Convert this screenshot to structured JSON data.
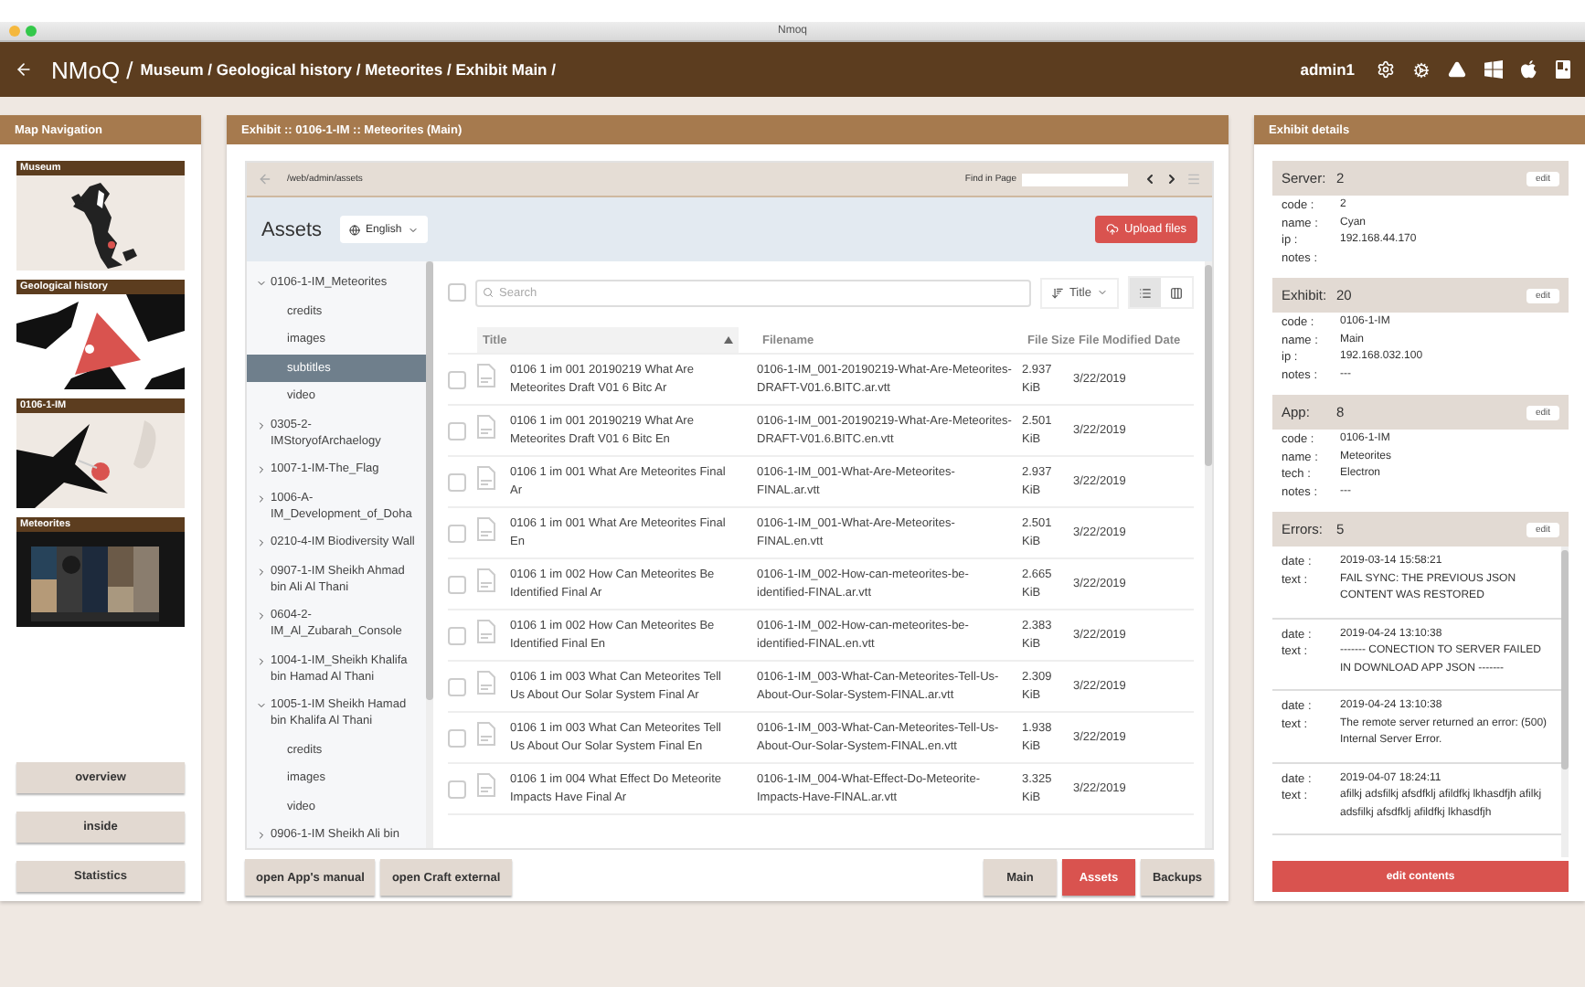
{
  "window": {
    "title": "Nmoq"
  },
  "header": {
    "root": "NMoQ /",
    "breadcrumb": "Museum / Geological history / Meteorites / Exhibit Main /",
    "user": "admin1"
  },
  "map_navigation": {
    "title": "Map Navigation",
    "maps": [
      {
        "label": "Museum",
        "kind": "museum"
      },
      {
        "label": "Geological history",
        "kind": "geology"
      },
      {
        "label": "0106-1-IM",
        "kind": "exhibit"
      },
      {
        "label": "Meteorites",
        "kind": "screenshot"
      }
    ],
    "buttons": [
      "overview",
      "inside",
      "Statistics"
    ]
  },
  "exhibit": {
    "title": "Exhibit :: 0106-1-IM :: Meteorites (Main)",
    "path": "/web/admin/assets",
    "find_label": "Find in Page",
    "assets_title": "Assets",
    "language": "English",
    "upload_button": "Upload files",
    "tree": [
      {
        "label": "0106-1-IM_Meteorites",
        "expanded": true,
        "selected": false,
        "children": [
          {
            "label": "credits",
            "selected": false
          },
          {
            "label": "images",
            "selected": false
          },
          {
            "label": "subtitles",
            "selected": true
          },
          {
            "label": "video",
            "selected": false
          }
        ]
      },
      {
        "label": "0305-2-IMStoryofArchaelogy",
        "expanded": false,
        "selected": false
      },
      {
        "label": "1007-1-IM-The_Flag",
        "expanded": false,
        "selected": false
      },
      {
        "label": "1006-A-IM_Development_of_Doha",
        "expanded": false,
        "selected": false
      },
      {
        "label": "0210-4-IM Biodiversity Wall",
        "expanded": false,
        "selected": false
      },
      {
        "label": "0907-1-IM Sheikh Ahmad bin Ali Al Thani",
        "expanded": false,
        "selected": false
      },
      {
        "label": "0604-2-IM_Al_Zubarah_Console",
        "expanded": false,
        "selected": false
      },
      {
        "label": "1004-1-IM_Sheikh Khalifa bin Hamad Al Thani",
        "expanded": false,
        "selected": false
      },
      {
        "label": "1005-1-IM Sheikh Hamad bin Khalifa Al Thani",
        "expanded": true,
        "selected": false,
        "children": [
          {
            "label": "credits",
            "selected": false
          },
          {
            "label": "images",
            "selected": false
          },
          {
            "label": "video",
            "selected": false
          }
        ]
      },
      {
        "label": "0906-1-IM Sheikh Ali bin",
        "expanded": false,
        "selected": false
      }
    ],
    "select_all": {
      "checked": false
    },
    "search": {
      "placeholder": "Search"
    },
    "sort_by": "Title",
    "views": [
      {
        "kind": "list",
        "selected": true
      },
      {
        "kind": "grid",
        "selected": false
      }
    ],
    "table": {
      "columns": [
        {
          "label": "Title",
          "sorted": true
        },
        {
          "label": "Filename",
          "sorted": false
        },
        {
          "label": "File Size",
          "sorted": false
        },
        {
          "label": "File Modified Date",
          "sorted": false
        }
      ],
      "rows": [
        {
          "checked": false,
          "title": "0106 1 im 001 20190219 What Are Meteorites Draft V01 6 Bitc Ar",
          "filename": "0106-1-IM_001-20190219-What-Are-Meteorites-DRAFT-V01.6.BITC.ar.vtt",
          "size": "2.937 KiB",
          "date": "3/22/2019"
        },
        {
          "checked": false,
          "title": "0106 1 im 001 20190219 What Are Meteorites Draft V01 6 Bitc En",
          "filename": "0106-1-IM_001-20190219-What-Are-Meteorites-DRAFT-V01.6.BITC.en.vtt",
          "size": "2.501 KiB",
          "date": "3/22/2019"
        },
        {
          "checked": false,
          "title": "0106 1 im 001 What Are Meteorites Final Ar",
          "filename": "0106-1-IM_001-What-Are-Meteorites-FINAL.ar.vtt",
          "size": "2.937 KiB",
          "date": "3/22/2019"
        },
        {
          "checked": false,
          "title": "0106 1 im 001 What Are Meteorites Final En",
          "filename": "0106-1-IM_001-What-Are-Meteorites-FINAL.en.vtt",
          "size": "2.501 KiB",
          "date": "3/22/2019"
        },
        {
          "checked": false,
          "title": "0106 1 im 002 How Can Meteorites Be Identified Final Ar",
          "filename": "0106-1-IM_002-How-can-meteorites-be-identified-FINAL.ar.vtt",
          "size": "2.665 KiB",
          "date": "3/22/2019"
        },
        {
          "checked": false,
          "title": "0106 1 im 002 How Can Meteorites Be Identified Final En",
          "filename": "0106-1-IM_002-How-can-meteorites-be-identified-FINAL.en.vtt",
          "size": "2.383 KiB",
          "date": "3/22/2019"
        },
        {
          "checked": false,
          "title": "0106 1 im 003 What Can Meteorites Tell Us About Our Solar System Final Ar",
          "filename": "0106-1-IM_003-What-Can-Meteorites-Tell-Us-About-Our-Solar-System-FINAL.ar.vtt",
          "size": "2.309 KiB",
          "date": "3/22/2019"
        },
        {
          "checked": false,
          "title": "0106 1 im 003 What Can Meteorites Tell Us About Our Solar System Final En",
          "filename": "0106-1-IM_003-What-Can-Meteorites-Tell-Us-About-Our-Solar-System-FINAL.en.vtt",
          "size": "1.938 KiB",
          "date": "3/22/2019"
        },
        {
          "checked": false,
          "title": "0106 1 im 004 What Effect Do Meteorite Impacts Have Final Ar",
          "filename": "0106-1-IM_004-What-Effect-Do-Meteorite-Impacts-Have-FINAL.ar.vtt",
          "size": "3.325 KiB",
          "date": "3/22/2019"
        }
      ]
    },
    "actions": [
      "open App's manual",
      "open Craft external"
    ],
    "tabs": [
      {
        "label": "Main",
        "selected": false
      },
      {
        "label": "Assets",
        "selected": true
      },
      {
        "label": "Backups",
        "selected": false
      }
    ]
  },
  "details": {
    "title": "Exhibit details",
    "cards": [
      {
        "title": "Server:",
        "value": "2",
        "edit": "edit",
        "fields": [
          {
            "key": "code :",
            "value": "2"
          },
          {
            "key": "name :",
            "value": "Cyan"
          },
          {
            "key": "ip :",
            "value": "192.168.44.170"
          },
          {
            "key": "notes :"
          }
        ]
      },
      {
        "title": "Exhibit:",
        "value": "20",
        "edit": "edit",
        "fields": [
          {
            "key": "code :",
            "value": "0106-1-IM"
          },
          {
            "key": "name :",
            "value": "Main"
          },
          {
            "key": "ip :",
            "value": "192.168.032.100"
          },
          {
            "key": "notes :",
            "value": "---"
          }
        ]
      },
      {
        "title": "App:",
        "value": "8",
        "edit": "edit",
        "fields": [
          {
            "key": "code :",
            "value": "0106-1-IM"
          },
          {
            "key": "name :",
            "value": "Meteorites"
          },
          {
            "key": "tech :",
            "value": "Electron"
          },
          {
            "key": "notes :",
            "value": "---"
          }
        ]
      }
    ],
    "errors": {
      "title": "Errors:",
      "value": "5",
      "edit": "edit",
      "items": [
        {
          "date_label": "date :",
          "date": "2019-03-14 15:58:21",
          "text_label": "text :",
          "text": "FAIL SYNC: THE PREVIOUS JSON CONTENT WAS RESTORED"
        },
        {
          "date_label": "date :",
          "date": "2019-04-24 13:10:38",
          "text_label": "text :",
          "text": "------- CONECTION TO SERVER FAILED IN DOWNLOAD APP JSON -------"
        },
        {
          "date_label": "date :",
          "date": "2019-04-24 13:10:38",
          "text_label": "text :",
          "text": "The remote server returned an error: (500) Internal Server Error."
        },
        {
          "date_label": "date :",
          "date": "2019-04-07 18:24:11",
          "text_label": "text :",
          "text": "afilkj adsfilkj afsdfklj afildfkj lkhasdfjh afilkj adsfilkj afsdfklj afildfkj lkhasdfjh"
        }
      ]
    },
    "edit_button": "edit contents"
  }
}
